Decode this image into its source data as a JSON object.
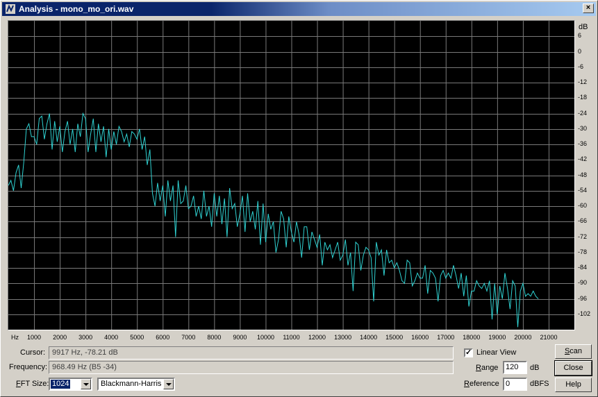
{
  "window": {
    "title": "Analysis - mono_mo_ori.wav",
    "close_glyph": "×"
  },
  "chart_data": {
    "type": "line",
    "xunit": "Hz",
    "yunit": "dB",
    "xlim": [
      0,
      22000
    ],
    "ylim": [
      -108,
      12
    ],
    "yticks": [
      6,
      0,
      -6,
      -12,
      -18,
      -24,
      -30,
      -36,
      -42,
      -48,
      -54,
      -60,
      -66,
      -72,
      -78,
      -84,
      -90,
      -96,
      -102
    ],
    "xticks": [
      1000,
      2000,
      3000,
      4000,
      5000,
      6000,
      7000,
      8000,
      9000,
      10000,
      11000,
      12000,
      13000,
      14000,
      15000,
      16000,
      17000,
      18000,
      19000,
      20000,
      21000
    ],
    "grid": true,
    "colors": {
      "background": "#000000",
      "grid": "#7a7a7a",
      "line": "#2fd2d2"
    },
    "series": [
      {
        "x": [
          0,
          100,
          200,
          300,
          400,
          500,
          600,
          700,
          800,
          900,
          1000,
          1100,
          1200,
          1300,
          1400,
          1500,
          1600,
          1700,
          1800,
          1900,
          2000,
          2100,
          2200,
          2300,
          2400,
          2500,
          2600,
          2700,
          2800,
          2900,
          3000,
          3100,
          3200,
          3300,
          3400,
          3500,
          3600,
          3700,
          3800,
          3900,
          4000,
          4100,
          4200,
          4300,
          4400,
          4500,
          4600,
          4700,
          4800,
          4900,
          5000,
          5100,
          5200,
          5300,
          5400,
          5500,
          5600,
          5700,
          5800,
          5900,
          6000,
          6100,
          6200,
          6300,
          6400,
          6500,
          6600,
          6700,
          6800,
          6900,
          7000,
          7100,
          7200,
          7300,
          7400,
          7500,
          7600,
          7700,
          7800,
          7900,
          8000,
          8100,
          8200,
          8300,
          8400,
          8500,
          8600,
          8700,
          8800,
          8900,
          9000,
          9100,
          9200,
          9300,
          9400,
          9500,
          9600,
          9700,
          9800,
          9900,
          10000,
          10100,
          10200,
          10300,
          10400,
          10500,
          10600,
          10700,
          10800,
          10900,
          11000,
          11100,
          11200,
          11300,
          11400,
          11500,
          11600,
          11700,
          11800,
          11900,
          12000,
          12100,
          12200,
          12300,
          12400,
          12500,
          12600,
          12700,
          12800,
          12900,
          13000,
          13100,
          13200,
          13300,
          13400,
          13500,
          13600,
          13700,
          13800,
          13900,
          14000,
          14100,
          14200,
          14300,
          14400,
          14500,
          14600,
          14700,
          14800,
          14900,
          15000,
          15100,
          15200,
          15300,
          15400,
          15500,
          15600,
          15700,
          15800,
          15900,
          16000,
          16100,
          16200,
          16300,
          16400,
          16500,
          16600,
          16700,
          16800,
          16900,
          17000,
          17100,
          17200,
          17300,
          17400,
          17500,
          17600,
          17700,
          17800,
          17900,
          18000,
          18100,
          18200,
          18300,
          18400,
          18500,
          18600,
          18700,
          18800,
          18900,
          19000,
          19100,
          19200,
          19300,
          19400,
          19500,
          19600,
          19700,
          19800,
          19900,
          20000,
          20100,
          20200,
          20300,
          20400,
          20500,
          20600
        ],
        "y": [
          -52,
          -50,
          -54,
          -47,
          -44,
          -53,
          -43,
          -30,
          -28,
          -33,
          -33,
          -36,
          -26,
          -25,
          -34,
          -28,
          -24,
          -38,
          -27,
          -35,
          -29,
          -39,
          -31,
          -27,
          -36,
          -30,
          -39,
          -28,
          -33,
          -24,
          -26,
          -39,
          -32,
          -26,
          -39,
          -28,
          -35,
          -29,
          -41,
          -30,
          -38,
          -31,
          -36,
          -29,
          -31,
          -35,
          -32,
          -37,
          -31,
          -32,
          -34,
          -30,
          -38,
          -33,
          -44,
          -38,
          -55,
          -60,
          -51,
          -58,
          -52,
          -64,
          -50,
          -58,
          -52,
          -72,
          -50,
          -59,
          -58,
          -52,
          -61,
          -60,
          -56,
          -64,
          -60,
          -65,
          -54,
          -64,
          -60,
          -68,
          -55,
          -64,
          -56,
          -67,
          -57,
          -72,
          -53,
          -61,
          -59,
          -68,
          -63,
          -56,
          -70,
          -55,
          -66,
          -62,
          -69,
          -58,
          -75,
          -59,
          -74,
          -63,
          -69,
          -66,
          -78,
          -73,
          -62,
          -65,
          -76,
          -64,
          -70,
          -74,
          -66,
          -71,
          -80,
          -68,
          -68,
          -77,
          -70,
          -73,
          -76,
          -71,
          -83,
          -74,
          -77,
          -75,
          -80,
          -77,
          -74,
          -81,
          -79,
          -73,
          -83,
          -78,
          -93,
          -74,
          -75,
          -85,
          -79,
          -76,
          -77,
          -80,
          -97,
          -74,
          -79,
          -77,
          -87,
          -77,
          -82,
          -81,
          -84,
          -82,
          -85,
          -89,
          -90,
          -81,
          -82,
          -91,
          -89,
          -86,
          -88,
          -88,
          -83,
          -94,
          -85,
          -86,
          -88,
          -97,
          -87,
          -85,
          -88,
          -86,
          -88,
          -83,
          -87,
          -92,
          -86,
          -95,
          -87,
          -99,
          -93,
          -93,
          -89,
          -91,
          -92,
          -90,
          -93,
          -89,
          -104,
          -90,
          -102,
          -91,
          -96,
          -86,
          -92,
          -100,
          -89,
          -91,
          -107,
          -93,
          -90,
          -95,
          -94,
          -95,
          -93,
          -95,
          -96
        ]
      }
    ]
  },
  "readouts": {
    "cursor_label": "Cursor:",
    "cursor_value": "9917 Hz, -78.21 dB",
    "frequency_label": "Frequency:",
    "frequency_value": "968.49 Hz (B5 -34)"
  },
  "fft": {
    "size_label_accel": "F",
    "size_label_rest": "FT Size:",
    "size_value": "1024",
    "window_value": "Blackmann-Harris"
  },
  "view": {
    "linear_view_checked": true,
    "check_glyph": "✓",
    "linear_view_label": "Linear View",
    "range_label_accel": "R",
    "range_label_rest": "ange",
    "range_value": "120",
    "range_unit": "dB",
    "reference_label_accel": "R",
    "reference_label_rest": "eference",
    "reference_value": "0",
    "reference_unit": "dBFS"
  },
  "buttons": {
    "scan_accel": "S",
    "scan_rest": "can",
    "close_label": "Close",
    "help_label": "Help"
  }
}
